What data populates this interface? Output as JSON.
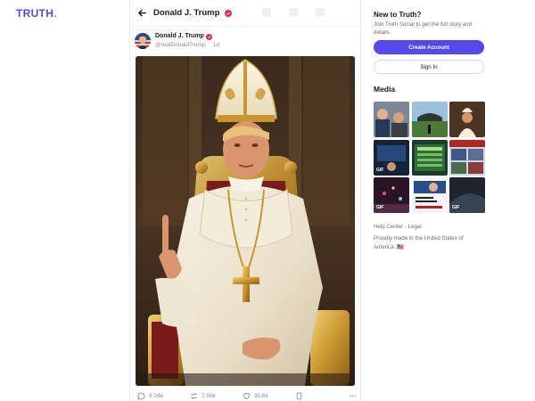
{
  "brand": {
    "logo_text": "TRUTH",
    "logo_dot": ".",
    "brand_color": "#5548d9",
    "dot_color": "#2ec4b6"
  },
  "header": {
    "back_icon": "arrow-left-icon",
    "title": "Donald J. Trump"
  },
  "post": {
    "author": "Donald J. Trump",
    "handle": "@realDonaldTrump",
    "separator": "·",
    "age": "1d",
    "verified_color": "#e0245e",
    "actions": {
      "replies": "9.04k",
      "retruths": "7.09k",
      "likes": "30.6k"
    }
  },
  "sidebar": {
    "new_title": "New to Truth?",
    "new_desc": "Join Truth Social to get the full story and details.",
    "create_label": "Create Account",
    "signin_label": "Sign In",
    "accent": "#5448ee",
    "media_title": "Media",
    "media_gif_label": "GIF",
    "footer_help": "Help Center",
    "footer_sep": "·",
    "footer_legal": "Legal",
    "footer_made": "Proudly made in the United States of America. 🇺🇸"
  }
}
